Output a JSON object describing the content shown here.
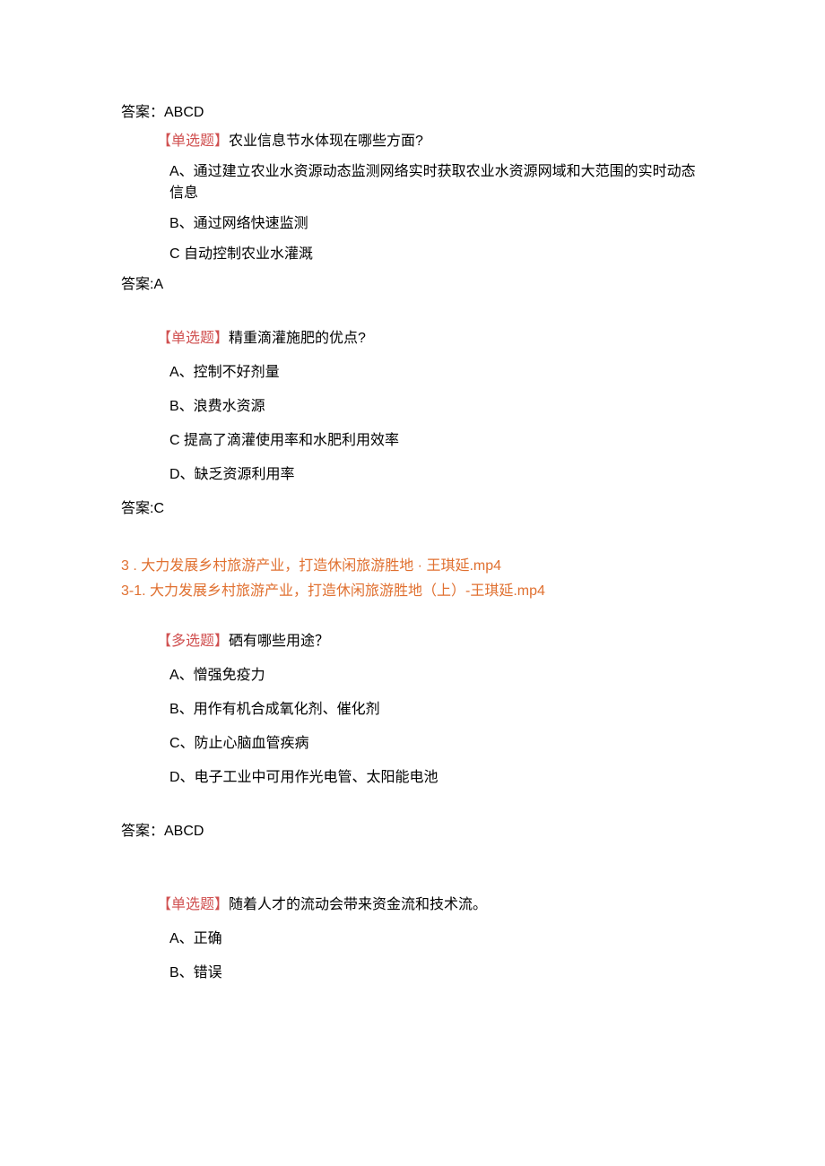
{
  "q1": {
    "answer_label": "答案：ABCD"
  },
  "q2": {
    "tag": "【单选题】",
    "question": "农业信息节水体现在哪些方面?",
    "options": {
      "a": "A、通过建立农业水资源动态监测网络实时获取农业水资源网域和大范围的实时动态信息",
      "b": "B、通过网络快速监测",
      "c": "C 自动控制农业水灌溉"
    },
    "answer_label": "答案:A"
  },
  "q3": {
    "tag": "【单选题】",
    "question": "精重滴灌施肥的优点?",
    "options": {
      "a": "A、控制不好剂量",
      "b": "B、浪费水资源",
      "c": "C 提高了滴灌使用率和水肥利用效率",
      "d": "D、缺乏资源利用率"
    },
    "answer_label": "答案:C"
  },
  "links": {
    "l1": "3 . 大力发展乡村旅游产业，打造休闲旅游胜地 · 王琪延.mp4",
    "l2": "3-1. 大力发展乡村旅游产业，打造休闲旅游胜地（上）-王琪延.mp4"
  },
  "q4": {
    "tag": "【多选题】",
    "question": "硒有哪些用途？",
    "options": {
      "a": "A、憎强免疫力",
      "b": "B、用作有机合成氧化剂、催化剂",
      "c": "C、防止心脑血管疾病",
      "d": "D、电子工业中可用作光电管、太阳能电池"
    },
    "answer_label": "答案：ABCD"
  },
  "q5": {
    "tag": "【单选题】",
    "question": "随着人才的流动会带来资金流和技术流。",
    "options": {
      "a": "A、正确",
      "b": "B、错误"
    }
  }
}
